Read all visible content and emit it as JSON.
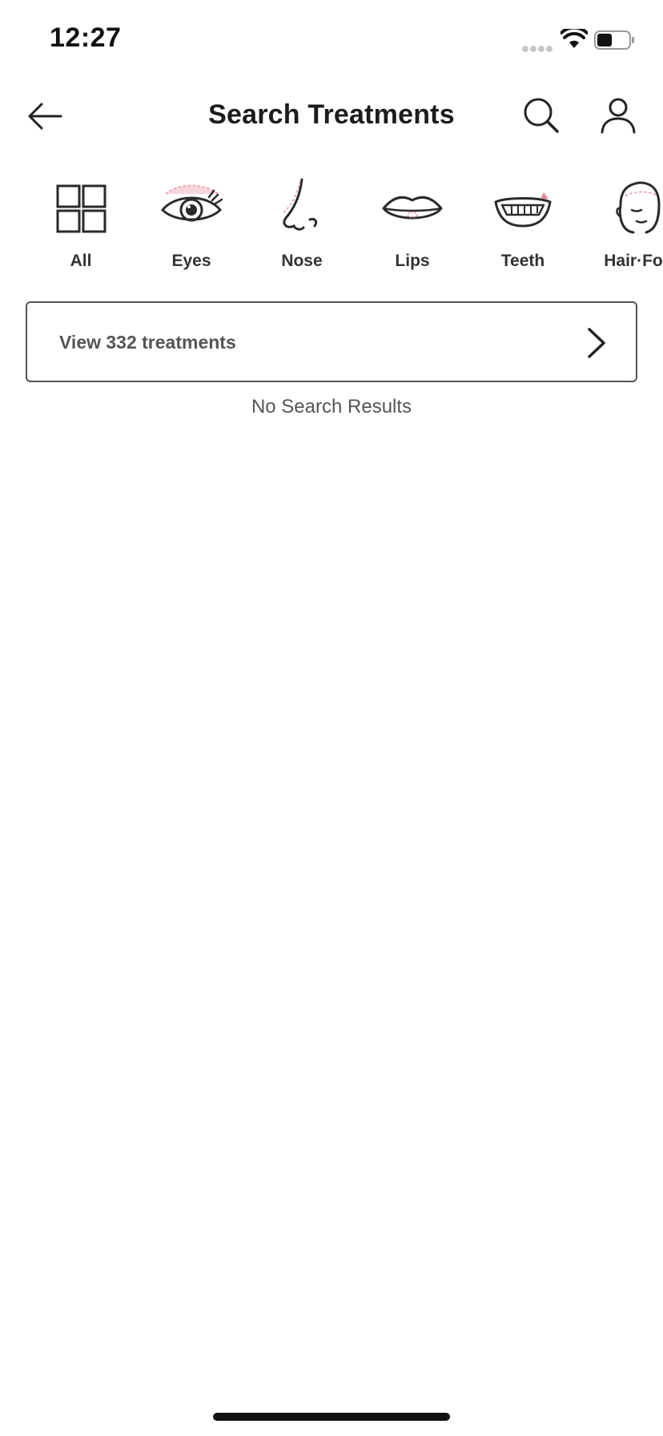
{
  "status_bar": {
    "time": "12:27",
    "icons": [
      "signal-dots-icon",
      "wifi-icon",
      "battery-icon"
    ]
  },
  "header": {
    "title": "Search Treatments",
    "back_icon": "arrow-left-icon",
    "search_icon": "search-icon",
    "profile_icon": "user-icon"
  },
  "categories": [
    {
      "label": "All",
      "icon": "grid-icon"
    },
    {
      "label": "Eyes",
      "icon": "eye-icon"
    },
    {
      "label": "Nose",
      "icon": "nose-icon"
    },
    {
      "label": "Lips",
      "icon": "lips-icon"
    },
    {
      "label": "Teeth",
      "icon": "teeth-icon"
    },
    {
      "label": "Hair·Fo",
      "icon": "face-icon"
    }
  ],
  "view_button": {
    "label": "View 332 treatments",
    "icon": "chevron-right-icon"
  },
  "results": {
    "empty_message": "No Search Results"
  },
  "colors": {
    "accent_pink": "#e8899a",
    "icon_stroke": "#2a2a2a",
    "border": "#555555",
    "text_muted": "#555555"
  }
}
